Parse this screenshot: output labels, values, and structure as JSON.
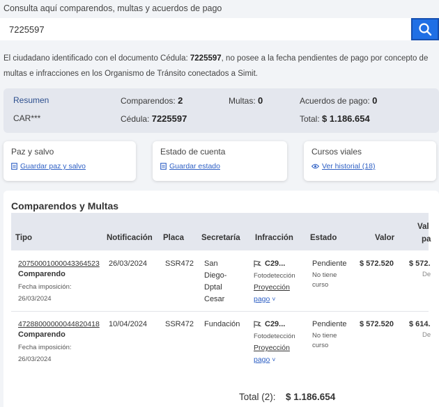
{
  "search": {
    "label": "Consulta aquí comparendos, multas y acuerdos de pago",
    "value": "7225597"
  },
  "notice": {
    "part1": "El ciudadano identificado con el documento ",
    "doc_label": "Cédula:",
    "doc_number": "7225597",
    "part2": ", no posee a la fecha pendientes de pago por concepto de multas e infracciones en los Organismo de Tránsito conectados a Simit."
  },
  "summary": {
    "resumen_label": "Resumen",
    "name": "CAR***",
    "comparendos_label": "Comparendos:",
    "comparendos_value": "2",
    "multas_label": "Multas:",
    "multas_value": "0",
    "acuerdos_label": "Acuerdos de pago:",
    "acuerdos_value": "0",
    "cedula_label": "Cédula:",
    "cedula_value": "7225597",
    "total_label": "Total:",
    "total_value": "$ 1.186.654"
  },
  "cards": [
    {
      "title": "Paz y salvo",
      "link": "Guardar paz y salvo",
      "icon": "document-icon"
    },
    {
      "title": "Estado de cuenta",
      "link": "Guardar estado",
      "icon": "document-icon"
    },
    {
      "title": "Cursos viales",
      "link": "Ver historial (18)",
      "icon": "eye-icon"
    }
  ],
  "table": {
    "title": "Comparendos y Multas",
    "headers": [
      "Tipo",
      "Notificación",
      "Placa",
      "Secretaría",
      "Infracción",
      "Estado",
      "Valor",
      "Val",
      "pa"
    ],
    "rows": [
      {
        "number": "20750001000043364523",
        "type": "Comparendo",
        "fecha_label": "Fecha imposición:",
        "fecha": "26/03/2024",
        "notificacion": "26/03/2024",
        "placa": "SSR472",
        "secretaria": [
          "San",
          "Diego-",
          "Dptal",
          "Cesar"
        ],
        "infraccion_code": "C29...",
        "infraccion_source": "Fotodetección",
        "proyeccion_1": "Proyección",
        "proyeccion_2": "pago",
        "estado": "Pendiente",
        "curso_1": "No tiene",
        "curso_2": "curso",
        "valor": "$ 572.520",
        "valor_pagar": "$ 572.",
        "extra": "De"
      },
      {
        "number": "47288000000044820418",
        "type": "Comparendo",
        "fecha_label": "Fecha imposición:",
        "fecha": "26/03/2024",
        "notificacion": "10/04/2024",
        "placa": "SSR472",
        "secretaria": [
          "Fundación"
        ],
        "infraccion_code": "C29...",
        "infraccion_source": "Fotodetección",
        "proyeccion_1": "Proyección",
        "proyeccion_2": "pago",
        "estado": "Pendiente",
        "curso_1": "No tiene",
        "curso_2": "curso",
        "valor": "$ 572.520",
        "valor_pagar": "$ 614.",
        "extra": "De"
      }
    ],
    "total_label": "Total (2):",
    "total_value": "$ 1.186.654"
  },
  "colors": {
    "accent": "#1f6fe5",
    "link": "#2d5fc4",
    "summary_bg": "#e4e7ee",
    "page_bg": "#f2f4f7"
  }
}
